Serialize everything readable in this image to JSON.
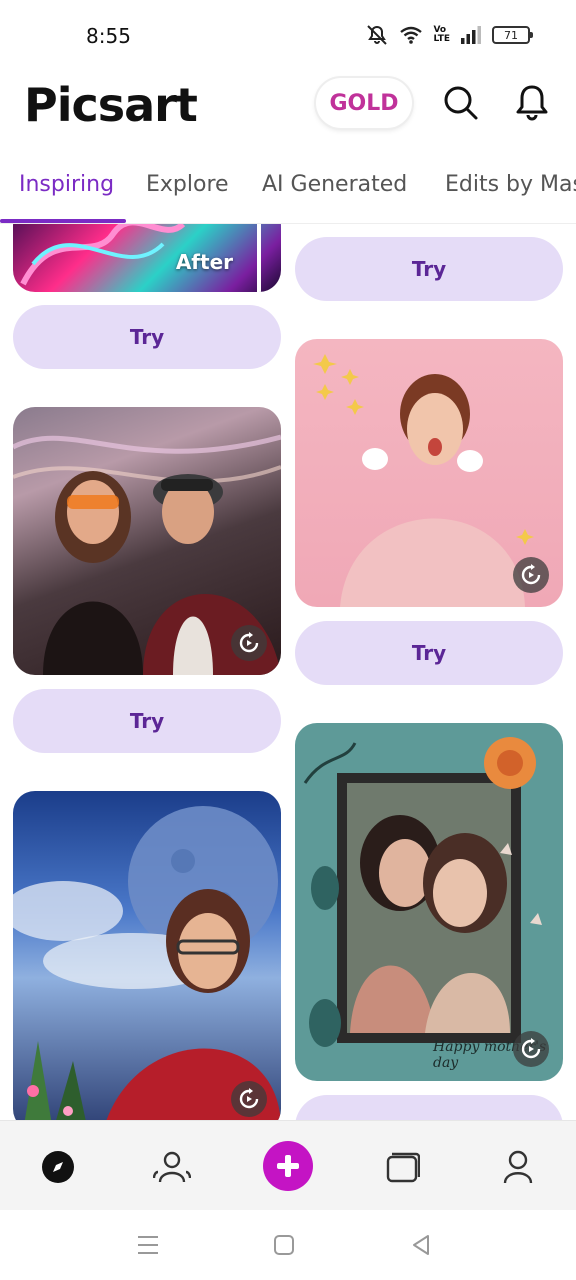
{
  "status_bar": {
    "time": "8:55",
    "battery": "71",
    "network": "VoLTE"
  },
  "header": {
    "logo": "Picsart",
    "gold_label": "GOLD"
  },
  "tabs": [
    {
      "label": "Inspiring",
      "active": true
    },
    {
      "label": "Explore",
      "active": false
    },
    {
      "label": "AI Generated",
      "active": false
    },
    {
      "label": "Edits by Mast",
      "active": false
    }
  ],
  "feed": {
    "after_label": "After",
    "try_label": "Try",
    "caption_text": "Happy mother's day"
  },
  "bottom_nav": {
    "items": [
      "discover-icon",
      "community-icon",
      "create-icon",
      "projects-icon",
      "profile-icon"
    ]
  },
  "colors": {
    "accent": "#7b2bc4",
    "try_bg": "#e5dcf7",
    "try_text": "#5b2696",
    "create": "#c414c4",
    "gold": "#c0329a"
  }
}
